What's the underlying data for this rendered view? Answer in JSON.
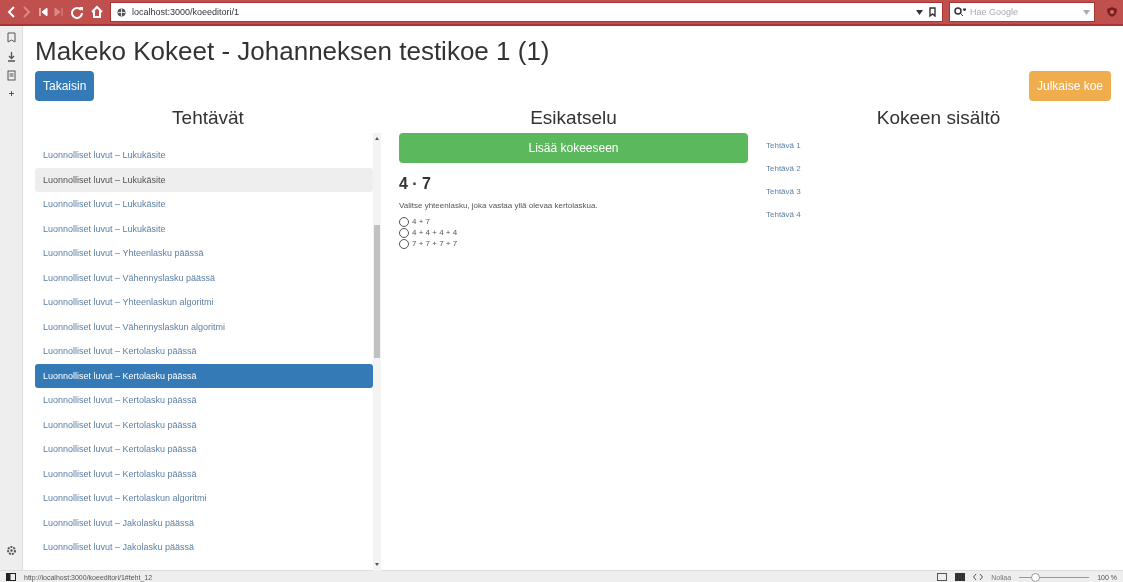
{
  "browser": {
    "url": "localhost:3000/koeeditori/1",
    "search": {
      "placeholder": "Hae Google"
    }
  },
  "page": {
    "title": "Makeko Kokeet - Johanneksen testikoe 1 (1)",
    "back_button": "Takaisin",
    "publish_button": "Julkaise koe"
  },
  "tasks": {
    "heading": "Tehtävät",
    "items": [
      {
        "label": "Luonnolliset luvut – Lukukäsite",
        "selected": false,
        "hovered": false
      },
      {
        "label": "Luonnolliset luvut – Lukukäsite",
        "selected": false,
        "hovered": true
      },
      {
        "label": "Luonnolliset luvut – Lukukäsite",
        "selected": false,
        "hovered": false
      },
      {
        "label": "Luonnolliset luvut – Lukukäsite",
        "selected": false,
        "hovered": false
      },
      {
        "label": "Luonnolliset luvut – Yhteenlasku päässä",
        "selected": false,
        "hovered": false
      },
      {
        "label": "Luonnolliset luvut – Vähennyslasku päässä",
        "selected": false,
        "hovered": false
      },
      {
        "label": "Luonnolliset luvut – Yhteenlaskun algoritmi",
        "selected": false,
        "hovered": false
      },
      {
        "label": "Luonnolliset luvut – Vähennyslaskun algoritmi",
        "selected": false,
        "hovered": false
      },
      {
        "label": "Luonnolliset luvut – Kertolasku päässä",
        "selected": false,
        "hovered": false
      },
      {
        "label": "Luonnolliset luvut – Kertolasku päässä",
        "selected": true,
        "hovered": false
      },
      {
        "label": "Luonnolliset luvut – Kertolasku päässä",
        "selected": false,
        "hovered": false
      },
      {
        "label": "Luonnolliset luvut – Kertolasku päässä",
        "selected": false,
        "hovered": false
      },
      {
        "label": "Luonnolliset luvut – Kertolasku päässä",
        "selected": false,
        "hovered": false
      },
      {
        "label": "Luonnolliset luvut – Kertolasku päässä",
        "selected": false,
        "hovered": false
      },
      {
        "label": "Luonnolliset luvut – Kertolaskun algoritmi",
        "selected": false,
        "hovered": false
      },
      {
        "label": "Luonnolliset luvut – Jakolasku päässä",
        "selected": false,
        "hovered": false
      },
      {
        "label": "Luonnolliset luvut – Jakolasku päässä",
        "selected": false,
        "hovered": false
      }
    ]
  },
  "preview": {
    "heading": "Esikatselu",
    "add_button": "Lisää kokeeseen",
    "question": "4 · 7",
    "instruction": "Valitse yhteenlasku, joka vastaa yllä olevaa kertolaskua.",
    "options": [
      {
        "label": "4 + 7",
        "selected": false
      },
      {
        "label": "4 + 4 + 4 + 4",
        "selected": false
      },
      {
        "label": "7 + 7 + 7 + 7",
        "selected": false
      }
    ]
  },
  "contents": {
    "heading": "Kokeen sisältö",
    "items": [
      "Tehtävä 1",
      "Tehtävä 2",
      "Tehtävä 3",
      "Tehtävä 4"
    ]
  },
  "status_bar": {
    "link": "http://localhost:3000/koeeditori/1#teht_12",
    "reset": "Nollaa",
    "zoom": {
      "level": 0.22,
      "reading": "100 %"
    }
  }
}
